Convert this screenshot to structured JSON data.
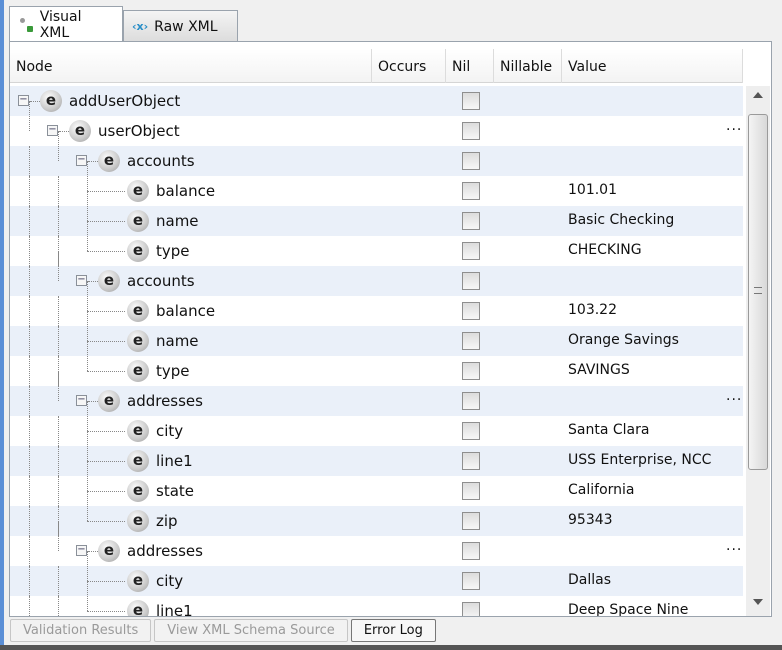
{
  "tabs": [
    {
      "label": "Visual XML",
      "icon": "visual-xml-icon",
      "active": true
    },
    {
      "label": "Raw XML",
      "icon": "raw-xml-icon",
      "active": false
    }
  ],
  "columns": [
    "Node",
    "Occurs",
    "Nil",
    "Nillable",
    "Value"
  ],
  "rows": [
    {
      "node": "addUserObject",
      "level": 0,
      "expandable": true,
      "value": "",
      "ellipsis": false
    },
    {
      "node": "userObject",
      "level": 1,
      "expandable": true,
      "value": "",
      "ellipsis": true
    },
    {
      "node": "accounts",
      "level": 2,
      "expandable": true,
      "value": "",
      "ellipsis": false
    },
    {
      "node": "balance",
      "level": 3,
      "expandable": false,
      "value": "101.01",
      "ellipsis": false
    },
    {
      "node": "name",
      "level": 3,
      "expandable": false,
      "value": "Basic Checking",
      "ellipsis": false
    },
    {
      "node": "type",
      "level": 3,
      "expandable": false,
      "value": "CHECKING",
      "ellipsis": false
    },
    {
      "node": "accounts",
      "level": 2,
      "expandable": true,
      "value": "",
      "ellipsis": false
    },
    {
      "node": "balance",
      "level": 3,
      "expandable": false,
      "value": "103.22",
      "ellipsis": false
    },
    {
      "node": "name",
      "level": 3,
      "expandable": false,
      "value": "Orange Savings",
      "ellipsis": false
    },
    {
      "node": "type",
      "level": 3,
      "expandable": false,
      "value": "SAVINGS",
      "ellipsis": false
    },
    {
      "node": "addresses",
      "level": 2,
      "expandable": true,
      "value": "",
      "ellipsis": true
    },
    {
      "node": "city",
      "level": 3,
      "expandable": false,
      "value": "Santa Clara",
      "ellipsis": false
    },
    {
      "node": "line1",
      "level": 3,
      "expandable": false,
      "value": "USS Enterprise, NCC",
      "ellipsis": false
    },
    {
      "node": "state",
      "level": 3,
      "expandable": false,
      "value": "California",
      "ellipsis": false
    },
    {
      "node": "zip",
      "level": 3,
      "expandable": false,
      "value": "95343",
      "ellipsis": false
    },
    {
      "node": "addresses",
      "level": 2,
      "expandable": true,
      "value": "",
      "ellipsis": true
    },
    {
      "node": "city",
      "level": 3,
      "expandable": false,
      "value": "Dallas",
      "ellipsis": false
    },
    {
      "node": "line1",
      "level": 3,
      "expandable": false,
      "value": "Deep Space Nine",
      "ellipsis": false
    }
  ],
  "ellipsis_text": "...",
  "element_glyph": "e",
  "bottom_tabs": [
    {
      "label": "Validation Results",
      "active": false
    },
    {
      "label": "View XML Schema Source",
      "active": false
    },
    {
      "label": "Error Log",
      "active": true
    }
  ]
}
